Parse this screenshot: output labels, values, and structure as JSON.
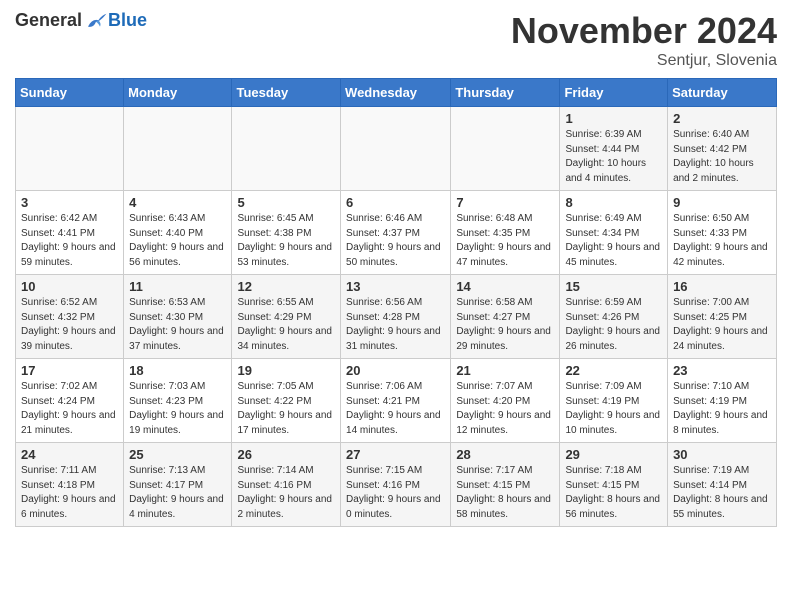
{
  "logo": {
    "general": "General",
    "blue": "Blue"
  },
  "title": "November 2024",
  "location": "Sentjur, Slovenia",
  "days_of_week": [
    "Sunday",
    "Monday",
    "Tuesday",
    "Wednesday",
    "Thursday",
    "Friday",
    "Saturday"
  ],
  "weeks": [
    [
      {
        "day": "",
        "info": ""
      },
      {
        "day": "",
        "info": ""
      },
      {
        "day": "",
        "info": ""
      },
      {
        "day": "",
        "info": ""
      },
      {
        "day": "",
        "info": ""
      },
      {
        "day": "1",
        "info": "Sunrise: 6:39 AM\nSunset: 4:44 PM\nDaylight: 10 hours and 4 minutes."
      },
      {
        "day": "2",
        "info": "Sunrise: 6:40 AM\nSunset: 4:42 PM\nDaylight: 10 hours and 2 minutes."
      }
    ],
    [
      {
        "day": "3",
        "info": "Sunrise: 6:42 AM\nSunset: 4:41 PM\nDaylight: 9 hours and 59 minutes."
      },
      {
        "day": "4",
        "info": "Sunrise: 6:43 AM\nSunset: 4:40 PM\nDaylight: 9 hours and 56 minutes."
      },
      {
        "day": "5",
        "info": "Sunrise: 6:45 AM\nSunset: 4:38 PM\nDaylight: 9 hours and 53 minutes."
      },
      {
        "day": "6",
        "info": "Sunrise: 6:46 AM\nSunset: 4:37 PM\nDaylight: 9 hours and 50 minutes."
      },
      {
        "day": "7",
        "info": "Sunrise: 6:48 AM\nSunset: 4:35 PM\nDaylight: 9 hours and 47 minutes."
      },
      {
        "day": "8",
        "info": "Sunrise: 6:49 AM\nSunset: 4:34 PM\nDaylight: 9 hours and 45 minutes."
      },
      {
        "day": "9",
        "info": "Sunrise: 6:50 AM\nSunset: 4:33 PM\nDaylight: 9 hours and 42 minutes."
      }
    ],
    [
      {
        "day": "10",
        "info": "Sunrise: 6:52 AM\nSunset: 4:32 PM\nDaylight: 9 hours and 39 minutes."
      },
      {
        "day": "11",
        "info": "Sunrise: 6:53 AM\nSunset: 4:30 PM\nDaylight: 9 hours and 37 minutes."
      },
      {
        "day": "12",
        "info": "Sunrise: 6:55 AM\nSunset: 4:29 PM\nDaylight: 9 hours and 34 minutes."
      },
      {
        "day": "13",
        "info": "Sunrise: 6:56 AM\nSunset: 4:28 PM\nDaylight: 9 hours and 31 minutes."
      },
      {
        "day": "14",
        "info": "Sunrise: 6:58 AM\nSunset: 4:27 PM\nDaylight: 9 hours and 29 minutes."
      },
      {
        "day": "15",
        "info": "Sunrise: 6:59 AM\nSunset: 4:26 PM\nDaylight: 9 hours and 26 minutes."
      },
      {
        "day": "16",
        "info": "Sunrise: 7:00 AM\nSunset: 4:25 PM\nDaylight: 9 hours and 24 minutes."
      }
    ],
    [
      {
        "day": "17",
        "info": "Sunrise: 7:02 AM\nSunset: 4:24 PM\nDaylight: 9 hours and 21 minutes."
      },
      {
        "day": "18",
        "info": "Sunrise: 7:03 AM\nSunset: 4:23 PM\nDaylight: 9 hours and 19 minutes."
      },
      {
        "day": "19",
        "info": "Sunrise: 7:05 AM\nSunset: 4:22 PM\nDaylight: 9 hours and 17 minutes."
      },
      {
        "day": "20",
        "info": "Sunrise: 7:06 AM\nSunset: 4:21 PM\nDaylight: 9 hours and 14 minutes."
      },
      {
        "day": "21",
        "info": "Sunrise: 7:07 AM\nSunset: 4:20 PM\nDaylight: 9 hours and 12 minutes."
      },
      {
        "day": "22",
        "info": "Sunrise: 7:09 AM\nSunset: 4:19 PM\nDaylight: 9 hours and 10 minutes."
      },
      {
        "day": "23",
        "info": "Sunrise: 7:10 AM\nSunset: 4:19 PM\nDaylight: 9 hours and 8 minutes."
      }
    ],
    [
      {
        "day": "24",
        "info": "Sunrise: 7:11 AM\nSunset: 4:18 PM\nDaylight: 9 hours and 6 minutes."
      },
      {
        "day": "25",
        "info": "Sunrise: 7:13 AM\nSunset: 4:17 PM\nDaylight: 9 hours and 4 minutes."
      },
      {
        "day": "26",
        "info": "Sunrise: 7:14 AM\nSunset: 4:16 PM\nDaylight: 9 hours and 2 minutes."
      },
      {
        "day": "27",
        "info": "Sunrise: 7:15 AM\nSunset: 4:16 PM\nDaylight: 9 hours and 0 minutes."
      },
      {
        "day": "28",
        "info": "Sunrise: 7:17 AM\nSunset: 4:15 PM\nDaylight: 8 hours and 58 minutes."
      },
      {
        "day": "29",
        "info": "Sunrise: 7:18 AM\nSunset: 4:15 PM\nDaylight: 8 hours and 56 minutes."
      },
      {
        "day": "30",
        "info": "Sunrise: 7:19 AM\nSunset: 4:14 PM\nDaylight: 8 hours and 55 minutes."
      }
    ]
  ]
}
